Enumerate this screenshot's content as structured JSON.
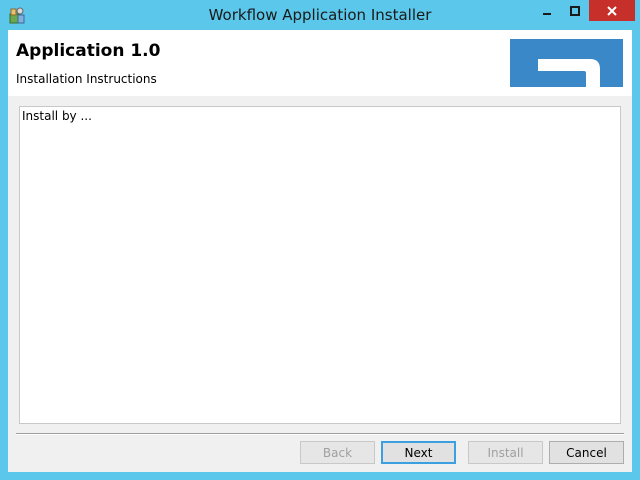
{
  "window": {
    "title": "Workflow Application Installer",
    "accent_color": "#5bc7ea",
    "close_color": "#c7302a"
  },
  "titlebar": {
    "app_icon": "installer-icon",
    "controls": [
      "minimize-icon",
      "maximize-icon",
      "close-icon"
    ]
  },
  "header": {
    "title": "Application 1.0",
    "subtitle": "Installation Instructions",
    "logo_color": "#3b88c8"
  },
  "instructions": {
    "text": "Install by ..."
  },
  "buttons": {
    "back": {
      "label": "Back",
      "enabled": false
    },
    "next": {
      "label": "Next",
      "enabled": true
    },
    "install": {
      "label": "Install",
      "enabled": false
    },
    "cancel": {
      "label": "Cancel",
      "enabled": true
    }
  }
}
